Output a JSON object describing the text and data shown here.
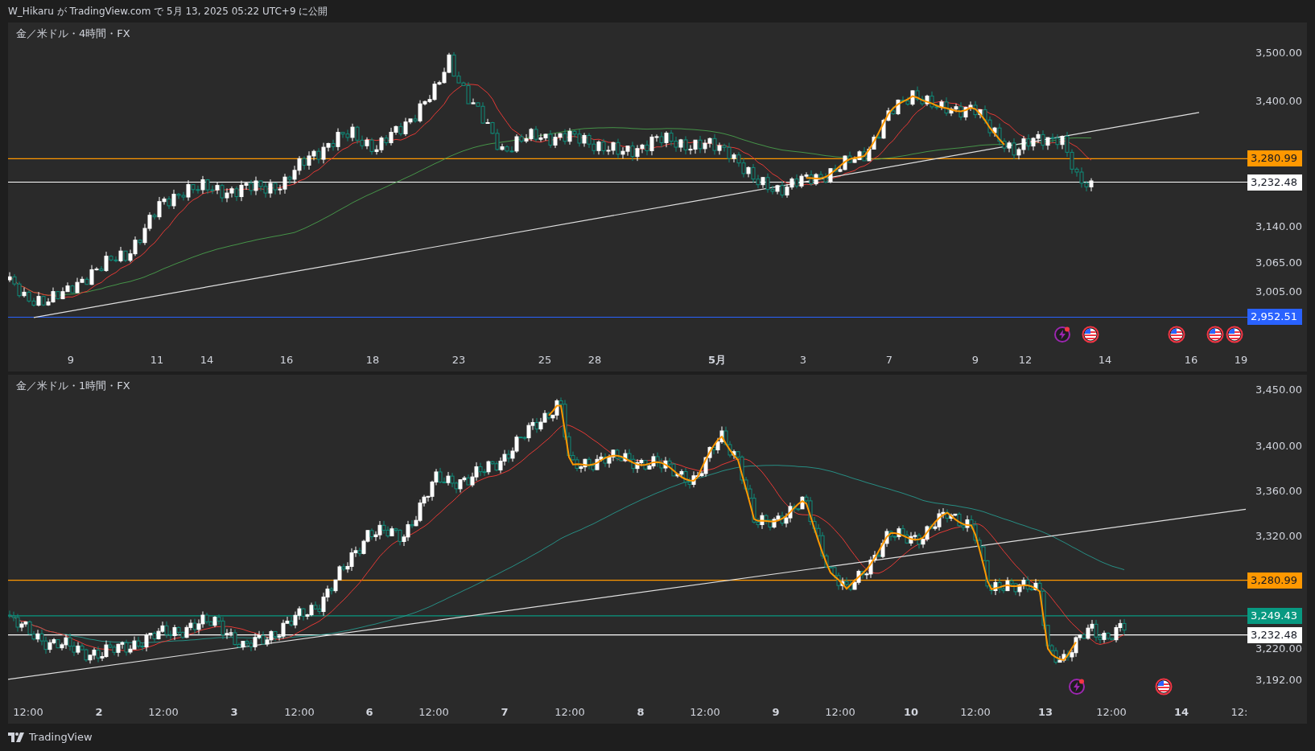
{
  "header": {
    "text": "W_Hikaru が TradingView.com で 5月 13, 2025 05:22 UTC+9 に公開"
  },
  "panes": [
    {
      "title": "金／米ドル・4時間・FX",
      "price_ticks": [
        "3,500.00",
        "3,400.00",
        "3,140.00",
        "3,065.00",
        "3,005.00"
      ],
      "price_tags": [
        {
          "label": "3,280.99",
          "color": "#ff9800"
        },
        {
          "label": "3,232.48",
          "color": "#ffffff"
        },
        {
          "label": "2,952.51",
          "color": "#2962ff"
        }
      ],
      "time_ticks": [
        {
          "label": "9",
          "kind": "time"
        },
        {
          "label": "11",
          "kind": "time"
        },
        {
          "label": "14",
          "kind": "time"
        },
        {
          "label": "16",
          "kind": "time"
        },
        {
          "label": "18",
          "kind": "time"
        },
        {
          "label": "23",
          "kind": "time"
        },
        {
          "label": "25",
          "kind": "time"
        },
        {
          "label": "28",
          "kind": "time"
        },
        {
          "label": "5月",
          "kind": "date"
        },
        {
          "label": "3",
          "kind": "time"
        },
        {
          "label": "7",
          "kind": "time"
        },
        {
          "label": "9",
          "kind": "time"
        },
        {
          "label": "12",
          "kind": "time"
        },
        {
          "label": "14",
          "kind": "time"
        },
        {
          "label": "16",
          "kind": "time"
        },
        {
          "label": "19",
          "kind": "time"
        }
      ],
      "events": [
        {
          "kind": "flash"
        },
        {
          "kind": "flag"
        },
        {
          "kind": "flag"
        },
        {
          "kind": "flag"
        },
        {
          "kind": "flag"
        }
      ]
    },
    {
      "title": "金／米ドル・1時間・FX",
      "price_ticks": [
        "3,450.00",
        "3,400.00",
        "3,360.00",
        "3,320.00",
        "3,220.00",
        "3,192.00"
      ],
      "price_tags": [
        {
          "label": "3,280.99",
          "color": "#ff9800"
        },
        {
          "label": "3,249.43",
          "color": "#089981"
        },
        {
          "label": "3,232.48",
          "color": "#ffffff"
        }
      ],
      "time_ticks": [
        {
          "label": "12:00",
          "kind": "time"
        },
        {
          "label": "2",
          "kind": "date"
        },
        {
          "label": "12:00",
          "kind": "time"
        },
        {
          "label": "3",
          "kind": "date"
        },
        {
          "label": "12:00",
          "kind": "time"
        },
        {
          "label": "6",
          "kind": "date"
        },
        {
          "label": "12:00",
          "kind": "time"
        },
        {
          "label": "7",
          "kind": "date"
        },
        {
          "label": "12:00",
          "kind": "time"
        },
        {
          "label": "8",
          "kind": "date"
        },
        {
          "label": "12:00",
          "kind": "time"
        },
        {
          "label": "9",
          "kind": "date"
        },
        {
          "label": "12:00",
          "kind": "time"
        },
        {
          "label": "10",
          "kind": "date"
        },
        {
          "label": "12:00",
          "kind": "time"
        },
        {
          "label": "13",
          "kind": "date"
        },
        {
          "label": "12:00",
          "kind": "time"
        },
        {
          "label": "14",
          "kind": "date"
        },
        {
          "label": "12:",
          "kind": "time"
        }
      ],
      "events": [
        {
          "kind": "flash"
        },
        {
          "kind": "flag"
        }
      ]
    }
  ],
  "footer": {
    "brand": "TradingView"
  }
}
